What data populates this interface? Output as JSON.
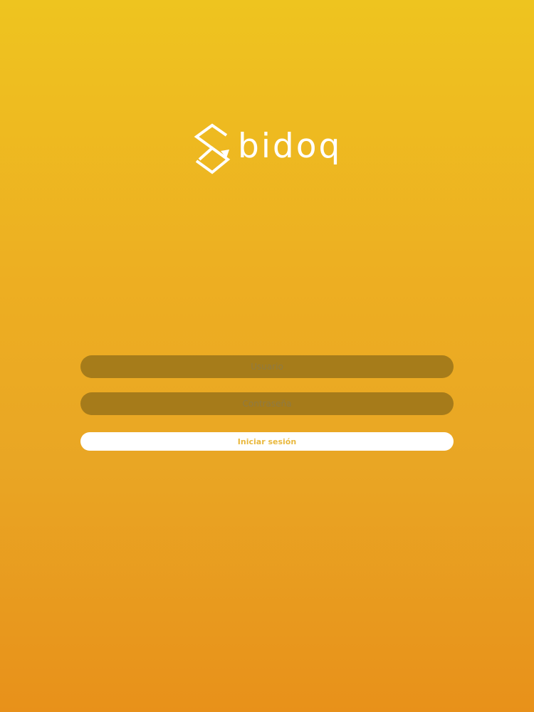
{
  "brand": {
    "name": "bidoq",
    "logo_icon": "stacked-diamond-logo-icon"
  },
  "login_form": {
    "user_placeholder": "Usuario",
    "user_value": "",
    "password_placeholder": "Contraseña",
    "password_value": "",
    "submit_label": "Iniciar sesión"
  },
  "colors": {
    "gradient_top": "#EEC41F",
    "gradient_bottom": "#E8911A",
    "field_background": "#8C6A1A",
    "button_background": "#FFFFFF",
    "button_text": "#E9B83E"
  }
}
